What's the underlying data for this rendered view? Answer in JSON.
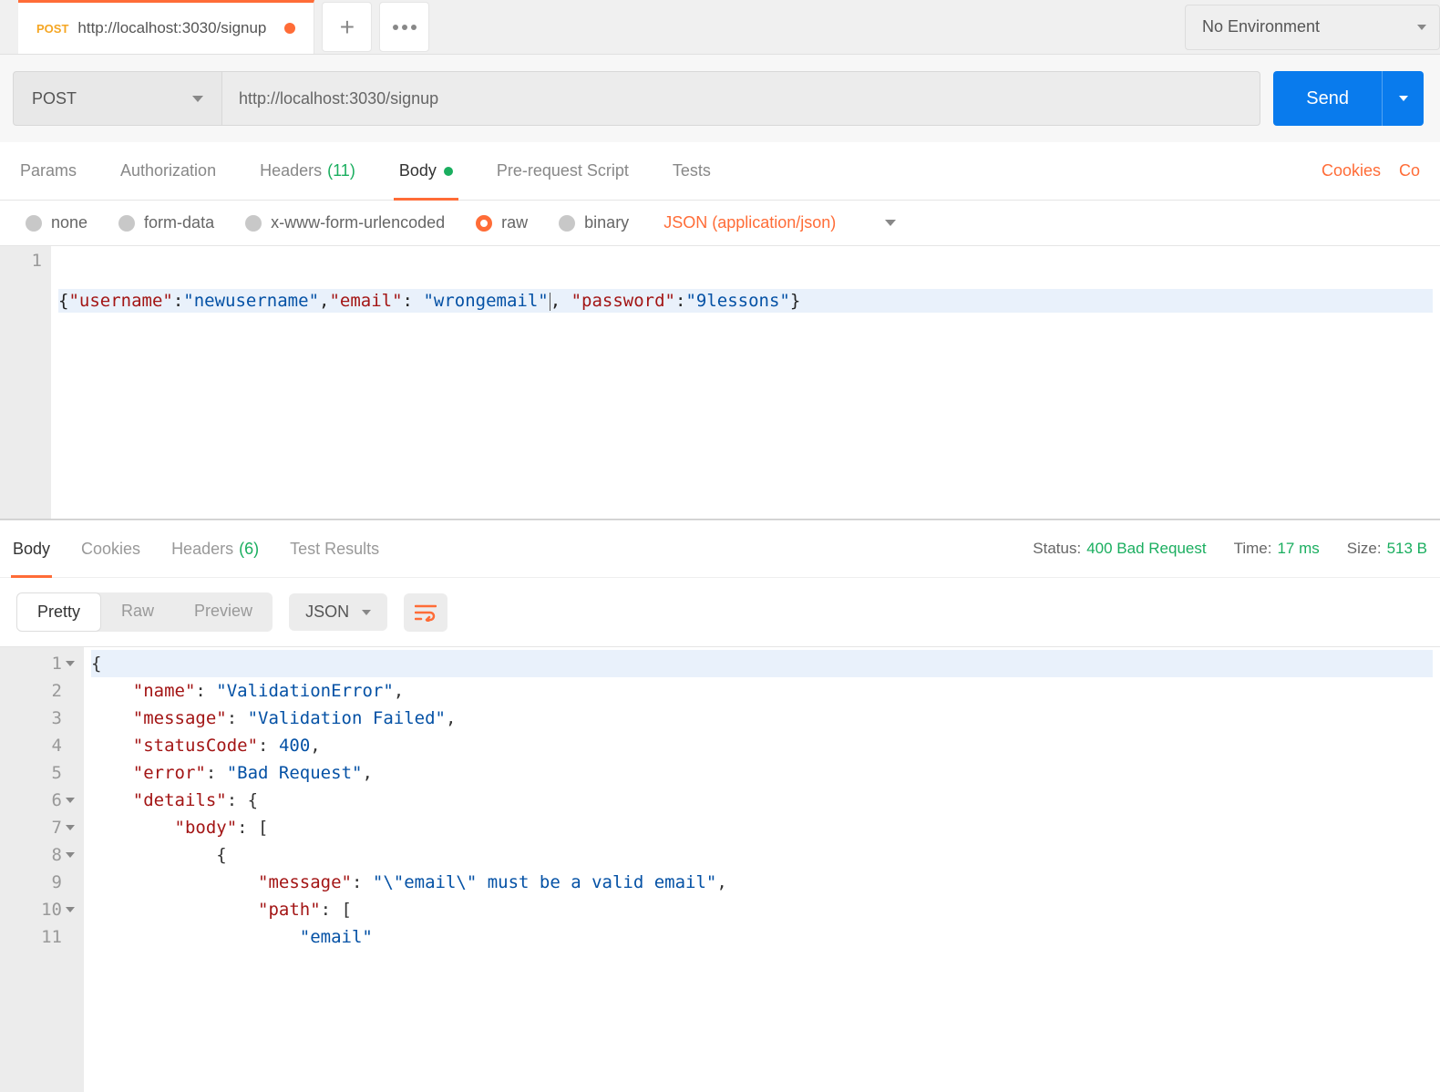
{
  "environment": {
    "label": "No Environment"
  },
  "tab": {
    "method": "POST",
    "title": "http://localhost:3030/signup",
    "dirty": true
  },
  "request": {
    "method": "POST",
    "url": "http://localhost:3030/signup",
    "send_label": "Send"
  },
  "request_tabs": {
    "params": "Params",
    "authorization": "Authorization",
    "headers": "Headers",
    "headers_count": "(11)",
    "body": "Body",
    "prerequest": "Pre-request Script",
    "tests": "Tests",
    "cookies": "Cookies",
    "code": "Co"
  },
  "body_types": {
    "none": "none",
    "formdata": "form-data",
    "urlencoded": "x-www-form-urlencoded",
    "raw": "raw",
    "binary": "binary",
    "content_type": "JSON (application/json)"
  },
  "request_body": {
    "line_number": "1",
    "tokens": {
      "k_username": "\"username\"",
      "v_username": "\"newusername\"",
      "k_email": "\"email\"",
      "v_email": "\"wrongemail\"",
      "k_password": "\"password\"",
      "v_password": "\"9lessons\""
    },
    "parsed": {
      "username": "newusername",
      "email": "wrongemail",
      "password": "9lessons"
    }
  },
  "response_tabs": {
    "body": "Body",
    "cookies": "Cookies",
    "headers": "Headers",
    "headers_count": "(6)",
    "test_results": "Test Results"
  },
  "response_meta": {
    "status_label": "Status:",
    "status_value": "400 Bad Request",
    "time_label": "Time:",
    "time_value": "17 ms",
    "size_label": "Size:",
    "size_value": "513 B"
  },
  "format_row": {
    "pretty": "Pretty",
    "raw": "Raw",
    "preview": "Preview",
    "format": "JSON"
  },
  "response_body": {
    "parsed": {
      "name": "ValidationError",
      "message": "Validation Failed",
      "statusCode": 400,
      "error": "Bad Request",
      "details": {
        "body": [
          {
            "message": "\"email\" must be a valid email",
            "path": [
              "email"
            ]
          }
        ]
      }
    },
    "lines": [
      {
        "n": "1",
        "fold": true,
        "indent": 0,
        "tokens": [
          {
            "t": "p",
            "v": "{"
          }
        ]
      },
      {
        "n": "2",
        "indent": 1,
        "tokens": [
          {
            "t": "k",
            "v": "\"name\""
          },
          {
            "t": "p",
            "v": ": "
          },
          {
            "t": "s",
            "v": "\"ValidationError\""
          },
          {
            "t": "p",
            "v": ","
          }
        ]
      },
      {
        "n": "3",
        "indent": 1,
        "tokens": [
          {
            "t": "k",
            "v": "\"message\""
          },
          {
            "t": "p",
            "v": ": "
          },
          {
            "t": "s",
            "v": "\"Validation Failed\""
          },
          {
            "t": "p",
            "v": ","
          }
        ]
      },
      {
        "n": "4",
        "indent": 1,
        "tokens": [
          {
            "t": "k",
            "v": "\"statusCode\""
          },
          {
            "t": "p",
            "v": ": "
          },
          {
            "t": "n",
            "v": "400"
          },
          {
            "t": "p",
            "v": ","
          }
        ]
      },
      {
        "n": "5",
        "indent": 1,
        "tokens": [
          {
            "t": "k",
            "v": "\"error\""
          },
          {
            "t": "p",
            "v": ": "
          },
          {
            "t": "s",
            "v": "\"Bad Request\""
          },
          {
            "t": "p",
            "v": ","
          }
        ]
      },
      {
        "n": "6",
        "fold": true,
        "indent": 1,
        "tokens": [
          {
            "t": "k",
            "v": "\"details\""
          },
          {
            "t": "p",
            "v": ": {"
          }
        ]
      },
      {
        "n": "7",
        "fold": true,
        "indent": 2,
        "tokens": [
          {
            "t": "k",
            "v": "\"body\""
          },
          {
            "t": "p",
            "v": ": ["
          }
        ]
      },
      {
        "n": "8",
        "fold": true,
        "indent": 3,
        "tokens": [
          {
            "t": "p",
            "v": "{"
          }
        ]
      },
      {
        "n": "9",
        "indent": 4,
        "tokens": [
          {
            "t": "k",
            "v": "\"message\""
          },
          {
            "t": "p",
            "v": ": "
          },
          {
            "t": "s",
            "v": "\"\\\"email\\\" must be a valid email\""
          },
          {
            "t": "p",
            "v": ","
          }
        ]
      },
      {
        "n": "10",
        "fold": true,
        "indent": 4,
        "tokens": [
          {
            "t": "k",
            "v": "\"path\""
          },
          {
            "t": "p",
            "v": ": ["
          }
        ]
      },
      {
        "n": "11",
        "indent": 5,
        "tokens": [
          {
            "t": "s",
            "v": "\"email\""
          }
        ]
      }
    ]
  }
}
